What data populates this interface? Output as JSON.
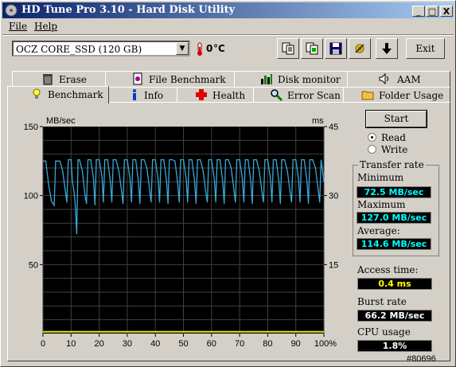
{
  "window": {
    "title": "HD Tune Pro 3.10 - Hard Disk Utility",
    "controls": {
      "minimize": "_",
      "maximize": "□",
      "close": "X"
    }
  },
  "menu": {
    "items": [
      "File",
      "Help"
    ]
  },
  "toolbar": {
    "drive": "OCZ CORE_SSD (120 GB)",
    "temperature": "0",
    "temperature_unit": "°C",
    "buttons": [
      "copy-text-icon",
      "copy-info-icon",
      "save-icon",
      "options-icon",
      "download-icon"
    ],
    "exit_label": "Exit"
  },
  "tabs": {
    "row_back": [
      {
        "label": "Erase",
        "icon": "trash-icon"
      },
      {
        "label": "File Benchmark",
        "icon": "file-icon"
      },
      {
        "label": "Disk monitor",
        "icon": "bar-chart-icon"
      },
      {
        "label": "AAM",
        "icon": "speaker-icon"
      }
    ],
    "row_front": [
      {
        "label": "Benchmark",
        "icon": "bulb-icon",
        "active": true
      },
      {
        "label": "Info",
        "icon": "info-icon"
      },
      {
        "label": "Health",
        "icon": "cross-icon"
      },
      {
        "label": "Error Scan",
        "icon": "magnifier-icon"
      },
      {
        "label": "Folder Usage",
        "icon": "folder-icon"
      }
    ]
  },
  "controls": {
    "start_label": "Start",
    "mode_read": "Read",
    "mode_write": "Write",
    "mode_selected": "Read"
  },
  "results": {
    "group_label": "Transfer rate",
    "minimum_label": "Minimum",
    "minimum_value": "72.5 MB/sec",
    "maximum_label": "Maximum",
    "maximum_value": "127.0 MB/sec",
    "average_label": "Average:",
    "average_value": "114.6 MB/sec",
    "access_label": "Access time:",
    "access_value": "0.4 ms",
    "burst_label": "Burst rate",
    "burst_value": "66.2 MB/sec",
    "cpu_label": "CPU usage",
    "cpu_value": "1.8%"
  },
  "watermark": "#80696",
  "chart_data": {
    "type": "line",
    "ylabel": "MB/sec",
    "y2label": "ms",
    "xlim": [
      0,
      100
    ],
    "ylim": [
      0,
      150
    ],
    "y2lim": [
      0,
      45
    ],
    "x_ticks": [
      "0",
      "10",
      "20",
      "30",
      "40",
      "50",
      "60",
      "70",
      "80",
      "90",
      "100%"
    ],
    "y_ticks": [
      "150",
      "100",
      "50"
    ],
    "y2_ticks": [
      "45",
      "30",
      "15"
    ],
    "grid": true,
    "colors": {
      "transfer": "#3aa8d8",
      "access": "#e8e800",
      "grid": "#404040"
    },
    "series": [
      {
        "key": "transfer",
        "x": [
          0,
          1,
          2,
          3,
          4,
          4.5,
          5,
          6,
          7,
          8,
          8.5,
          9,
          10,
          10.5,
          11,
          11.5,
          12,
          12.5,
          13,
          14,
          15,
          15.5,
          16,
          17,
          18,
          18.5,
          19,
          20,
          21,
          21.5,
          22,
          23,
          24,
          24.5,
          25,
          26,
          27,
          28,
          28.5,
          29,
          30,
          31,
          31.5,
          32,
          33,
          34,
          34.5,
          35,
          36,
          37,
          38,
          38.5,
          39,
          40,
          41,
          41.5,
          42,
          43,
          44,
          44.5,
          45,
          46,
          47,
          48,
          48.5,
          49,
          50,
          51,
          51.5,
          52,
          53,
          54,
          54.5,
          55,
          56,
          57,
          58,
          58.5,
          59,
          60,
          61,
          61.5,
          62,
          63,
          64,
          64.5,
          65,
          66,
          67,
          68,
          68.5,
          69,
          70,
          71,
          71.5,
          72,
          73,
          74,
          74.5,
          75,
          76,
          77,
          78,
          78.5,
          79,
          80,
          81,
          81.5,
          82,
          83,
          84,
          84.5,
          85,
          86,
          87,
          88,
          88.5,
          89,
          90,
          91,
          91.5,
          92,
          93,
          94,
          94.5,
          95,
          96,
          97,
          98,
          98.5,
          99,
          100
        ],
        "y": [
          125,
          125,
          108,
          96,
          93,
          125,
          125,
          125,
          118,
          103,
          95,
          126,
          126,
          110,
          104,
          93,
          72,
          126,
          126,
          118,
          100,
          94,
          126,
          126,
          112,
          93,
          126,
          126,
          114,
          95,
          126,
          126,
          110,
          95,
          126,
          126,
          118,
          103,
          94,
          126,
          126,
          112,
          95,
          126,
          126,
          110,
          94,
          126,
          126,
          120,
          104,
          95,
          126,
          126,
          112,
          95,
          126,
          126,
          110,
          94,
          126,
          126,
          125,
          108,
          95,
          126,
          126,
          112,
          95,
          126,
          126,
          110,
          94,
          126,
          126,
          118,
          102,
          95,
          126,
          126,
          112,
          95,
          126,
          126,
          110,
          94,
          126,
          126,
          120,
          104,
          95,
          126,
          126,
          112,
          95,
          126,
          126,
          110,
          94,
          126,
          126,
          118,
          102,
          95,
          126,
          126,
          112,
          95,
          126,
          126,
          110,
          94,
          126,
          126,
          118,
          102,
          95,
          126,
          126,
          112,
          95,
          126,
          126,
          110,
          94,
          126,
          126,
          120,
          104,
          95,
          126,
          110
        ]
      },
      {
        "key": "access",
        "x": [
          0,
          100
        ],
        "y": [
          0.4,
          0.4
        ]
      }
    ]
  }
}
